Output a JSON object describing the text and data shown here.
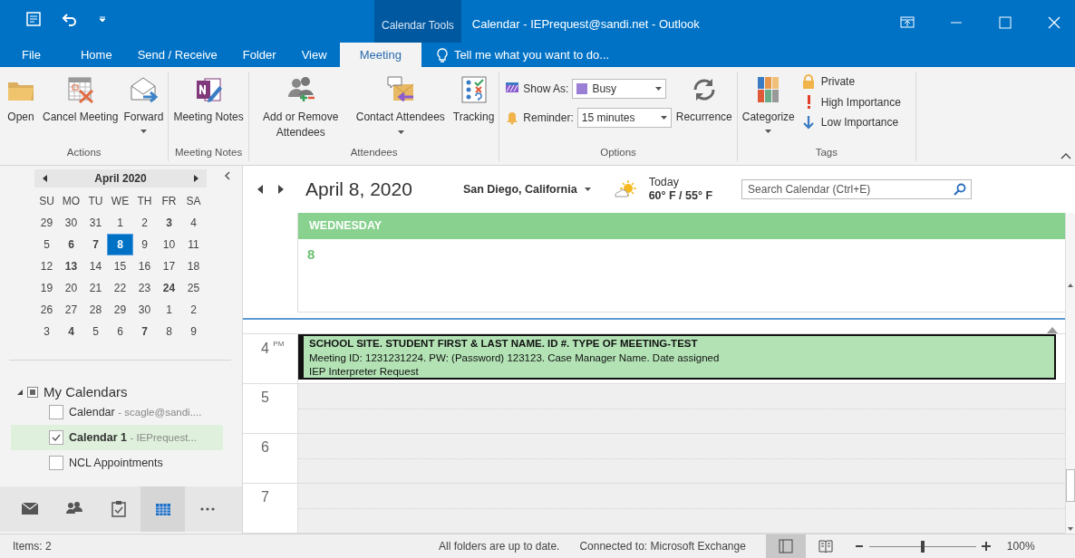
{
  "title_bar": {
    "contextual_tab": "Calendar Tools",
    "title": "Calendar - IEPrequest@sandi.net - Outlook"
  },
  "ribbon_tabs": [
    {
      "label": "File",
      "selected": false
    },
    {
      "label": "Home",
      "selected": false
    },
    {
      "label": "Send / Receive",
      "selected": false
    },
    {
      "label": "Folder",
      "selected": false
    },
    {
      "label": "View",
      "selected": false
    },
    {
      "label": "Meeting",
      "selected": true
    }
  ],
  "tell_me": {
    "placeholder": "Tell me what you want to do..."
  },
  "ribbon_groups": [
    {
      "label": "Actions",
      "kind": "large",
      "buttons": [
        {
          "kind": "open",
          "label": "Open",
          "dropdown": false
        },
        {
          "kind": "cancel",
          "label": "Cancel Meeting",
          "dropdown": false
        },
        {
          "kind": "forward",
          "label": "Forward",
          "dropdown": true
        }
      ]
    },
    {
      "label": "Meeting Notes",
      "kind": "large",
      "buttons": [
        {
          "kind": "notes",
          "label": "Meeting Notes",
          "dropdown": false
        }
      ]
    },
    {
      "label": "Attendees",
      "kind": "large",
      "buttons": [
        {
          "kind": "attendees",
          "label": "Add or Remove Attendees",
          "dropdown": false
        },
        {
          "kind": "contact",
          "label": "Contact Attendees",
          "dropdown": true
        },
        {
          "kind": "tracking",
          "label": "Tracking",
          "dropdown": false
        }
      ]
    },
    {
      "label": "Options",
      "kind": "options",
      "show_as": {
        "label": "Show As:",
        "value": "Busy"
      },
      "reminder": {
        "label": "Reminder:",
        "value": "15 minutes"
      },
      "buttons": [
        {
          "kind": "recurrence",
          "label": "Recurrence",
          "dropdown": false
        }
      ]
    },
    {
      "label": "Tags",
      "kind": "tags",
      "buttons": [
        {
          "kind": "categorize",
          "label": "Categorize",
          "dropdown": true
        }
      ],
      "small_buttons": [
        {
          "kind": "private",
          "label": "Private"
        },
        {
          "kind": "high",
          "label": "High Importance"
        },
        {
          "kind": "low",
          "label": "Low Importance"
        }
      ]
    }
  ],
  "mini_calendar": {
    "month": "April 2020",
    "weekdays": [
      "SU",
      "MO",
      "TU",
      "WE",
      "TH",
      "FR",
      "SA"
    ],
    "weeks": [
      [
        {
          "day": "29",
          "bold": false,
          "selected": false
        },
        {
          "day": "30",
          "bold": false,
          "selected": false
        },
        {
          "day": "31",
          "bold": false,
          "selected": false
        },
        {
          "day": "1",
          "bold": false,
          "selected": false
        },
        {
          "day": "2",
          "bold": false,
          "selected": false
        },
        {
          "day": "3",
          "bold": true,
          "selected": false
        },
        {
          "day": "4",
          "bold": false,
          "selected": false
        }
      ],
      [
        {
          "day": "5",
          "bold": false,
          "selected": false
        },
        {
          "day": "6",
          "bold": true,
          "selected": false
        },
        {
          "day": "7",
          "bold": true,
          "selected": false
        },
        {
          "day": "8",
          "bold": true,
          "selected": true
        },
        {
          "day": "9",
          "bold": false,
          "selected": false
        },
        {
          "day": "10",
          "bold": false,
          "selected": false
        },
        {
          "day": "11",
          "bold": false,
          "selected": false
        }
      ],
      [
        {
          "day": "12",
          "bold": false,
          "selected": false
        },
        {
          "day": "13",
          "bold": true,
          "selected": false
        },
        {
          "day": "14",
          "bold": false,
          "selected": false
        },
        {
          "day": "15",
          "bold": false,
          "selected": false
        },
        {
          "day": "16",
          "bold": false,
          "selected": false
        },
        {
          "day": "17",
          "bold": false,
          "selected": false
        },
        {
          "day": "18",
          "bold": false,
          "selected": false
        }
      ],
      [
        {
          "day": "19",
          "bold": false,
          "selected": false
        },
        {
          "day": "20",
          "bold": false,
          "selected": false
        },
        {
          "day": "21",
          "bold": false,
          "selected": false
        },
        {
          "day": "22",
          "bold": false,
          "selected": false
        },
        {
          "day": "23",
          "bold": false,
          "selected": false
        },
        {
          "day": "24",
          "bold": true,
          "selected": false
        },
        {
          "day": "25",
          "bold": false,
          "selected": false
        }
      ],
      [
        {
          "day": "26",
          "bold": false,
          "selected": false
        },
        {
          "day": "27",
          "bold": false,
          "selected": false
        },
        {
          "day": "28",
          "bold": false,
          "selected": false
        },
        {
          "day": "29",
          "bold": false,
          "selected": false
        },
        {
          "day": "30",
          "bold": false,
          "selected": false
        },
        {
          "day": "1",
          "bold": false,
          "selected": false
        },
        {
          "day": "2",
          "bold": false,
          "selected": false
        }
      ],
      [
        {
          "day": "3",
          "bold": false,
          "selected": false
        },
        {
          "day": "4",
          "bold": true,
          "selected": false
        },
        {
          "day": "5",
          "bold": false,
          "selected": false
        },
        {
          "day": "6",
          "bold": false,
          "selected": false
        },
        {
          "day": "7",
          "bold": true,
          "selected": false
        },
        {
          "day": "8",
          "bold": false,
          "selected": false
        },
        {
          "day": "9",
          "bold": false,
          "selected": false
        }
      ]
    ]
  },
  "calendar_group": {
    "label": "My Calendars",
    "expanded": true,
    "items": [
      {
        "name": "Calendar",
        "detail": "- scagle@sandi....",
        "checked": false,
        "selected": false
      },
      {
        "name": "Calendar  1",
        "detail": "- IEPrequest...",
        "checked": true,
        "selected": true
      },
      {
        "name": "NCL Appointments",
        "checked": false,
        "selected": false
      }
    ]
  },
  "nav_bar": [
    {
      "kind": "mail",
      "selected": false
    },
    {
      "kind": "people",
      "selected": false
    },
    {
      "kind": "tasks",
      "selected": false
    },
    {
      "kind": "calendar",
      "selected": true
    },
    {
      "kind": "more",
      "selected": false
    }
  ],
  "calendar_header": {
    "date": "April 8, 2020",
    "location": "San Diego, California",
    "weather_label": "Today",
    "temperature": "60° F / 55° F",
    "search": {
      "placeholder": "Search Calendar (Ctrl+E)"
    }
  },
  "day_column": {
    "weekday": "WEDNESDAY",
    "day": "8"
  },
  "hours": [
    {
      "hour": "4",
      "suffix": "PM"
    },
    {
      "hour": "5"
    },
    {
      "hour": "6"
    },
    {
      "hour": "7"
    }
  ],
  "event": {
    "title": "SCHOOL SITE. STUDENT FIRST & LAST NAME. ID #. TYPE OF MEETING-TEST",
    "line_1": "Meeting ID: 1231231224. PW: (Password) 123123. Case Manager Name. Date assigned",
    "line_2": "IEP Interpreter Request"
  },
  "status_bar": {
    "items": "Items: 2",
    "sync": "All folders are up to date.",
    "connection": "Connected to: Microsoft Exchange",
    "views": [
      {
        "kind": "normal",
        "selected": true
      },
      {
        "kind": "reading",
        "selected": false
      }
    ],
    "zoom": {
      "level": 0.5,
      "reading": "100%"
    }
  }
}
